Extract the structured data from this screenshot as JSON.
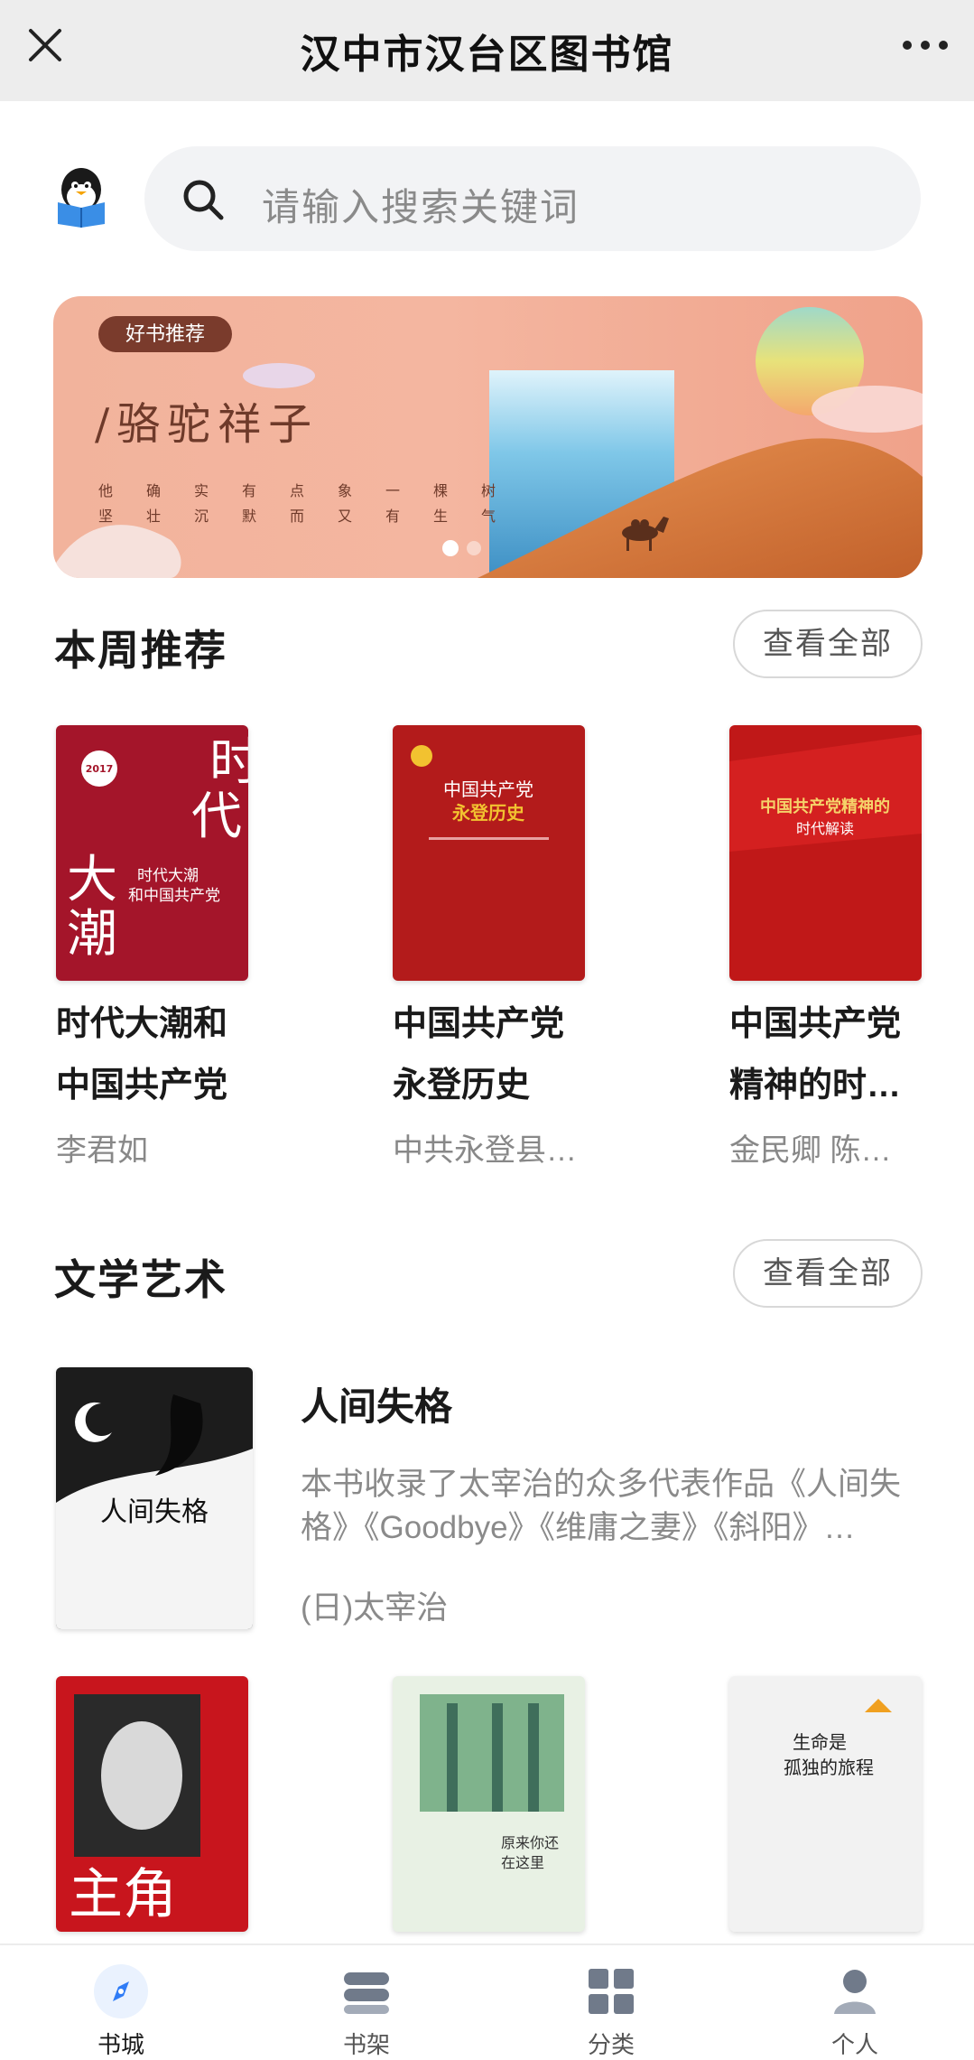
{
  "app": {
    "title": "汉中市汉台区图书馆",
    "close_icon": "close-icon",
    "more_icon": "more-dots-icon"
  },
  "search": {
    "placeholder": "请输入搜索关键词",
    "icon": "search-icon"
  },
  "banner": {
    "tag": "好书推荐",
    "book_title": "/骆驼祥子",
    "quote_line1": "他确实有点象一棵树",
    "quote_line2": "坚壮沉默而又有生气",
    "slide_count": 2,
    "active_slide": 1
  },
  "weekly": {
    "title": "本周推荐",
    "view_all": "查看全部",
    "books": [
      {
        "title": "时代大潮和中国共产党",
        "author": "李君如",
        "cover": {
          "bg": "#a4152a",
          "line1": "时代大潮",
          "line2": "和中国共产党",
          "big_chars": "时代大潮",
          "badge": "2017"
        }
      },
      {
        "title": "中国共产党永登历史",
        "author": "中共永登县…",
        "cover": {
          "bg": "#b31b1b",
          "line1": "中国共产党",
          "line2": "永登历史"
        }
      },
      {
        "title": "中国共产党精神的时…",
        "author": "金民卿 陈…",
        "cover": {
          "bg": "#c01818",
          "line1": "中国共产党精神的",
          "line2": "时代解读"
        }
      }
    ]
  },
  "literature": {
    "title": "文学艺术",
    "view_all": "查看全部",
    "featured": {
      "title": "人间失格",
      "description": "本书收录了太宰治的众多代表作品《人间失格》《Goodbye》《维庸之妻》《斜阳》…",
      "author": "(日)太宰治",
      "cover_text": "人间失格"
    },
    "more_books": [
      {
        "cover_text": "主角",
        "bg": "#c8151d"
      },
      {
        "cover_text1": "原来你还",
        "cover_text2": "在这里",
        "bg": "#e8f1e4"
      },
      {
        "cover_text1": "生命是",
        "cover_text2": "孤独的旅程",
        "bg": "#f2f2f2"
      }
    ]
  },
  "nav": {
    "items": [
      {
        "label": "书城",
        "icon": "compass-icon",
        "active": true
      },
      {
        "label": "书架",
        "icon": "bookshelf-icon",
        "active": false
      },
      {
        "label": "分类",
        "icon": "grid-icon",
        "active": false
      },
      {
        "label": "个人",
        "icon": "person-icon",
        "active": false
      }
    ]
  },
  "colors": {
    "accent": "#2f7cf6",
    "topbar_bg": "#ededed",
    "banner_bg": "#f2b39c",
    "icon_gray": "#707a8a"
  }
}
